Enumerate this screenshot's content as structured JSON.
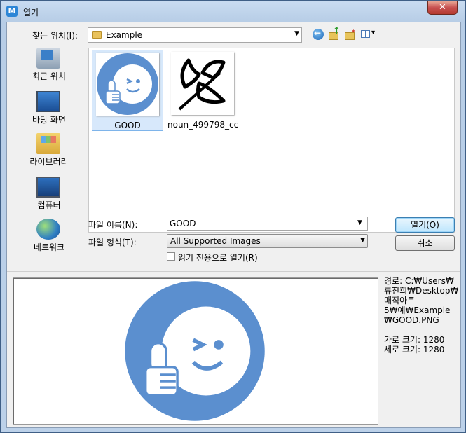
{
  "window": {
    "title": "열기",
    "close_glyph": "✕"
  },
  "toolbar": {
    "look_in_label": "찾는 위치(I):",
    "look_in_value": "Example",
    "icons": [
      "back-icon",
      "up-folder-icon",
      "new-folder-icon",
      "view-menu-icon"
    ]
  },
  "places": [
    {
      "label": "최근 위치",
      "icon": "recent-places-icon"
    },
    {
      "label": "바탕 화면",
      "icon": "desktop-icon"
    },
    {
      "label": "라이브러리",
      "icon": "library-icon"
    },
    {
      "label": "컴퓨터",
      "icon": "computer-icon"
    },
    {
      "label": "네트워크",
      "icon": "network-icon"
    }
  ],
  "files": [
    {
      "name": "GOOD",
      "selected": true,
      "thumbnail": "wink-thumbs-up-icon"
    },
    {
      "name": "noun_499798_cc",
      "selected": false,
      "thumbnail": "leaf-icon"
    }
  ],
  "form": {
    "file_name_label": "파일 이름(N):",
    "file_name_value": "GOOD",
    "file_type_label": "파일 형식(T):",
    "file_type_value": "All Supported Images",
    "read_only_label": "읽기 전용으로 열기(R)",
    "read_only_checked": false
  },
  "buttons": {
    "open": "열기(O)",
    "cancel": "취소"
  },
  "info": {
    "path_lines": [
      "경로: C:₩Users₩",
      "류진희₩Desktop₩",
      "매직아트",
      "5₩예₩Example",
      "₩GOOD.PNG"
    ],
    "width_line": "가로 크기: 1280",
    "height_line": "세로 크기: 1280"
  },
  "colors": {
    "accent": "#5b8fcf",
    "selection": "#d7e8fb"
  }
}
